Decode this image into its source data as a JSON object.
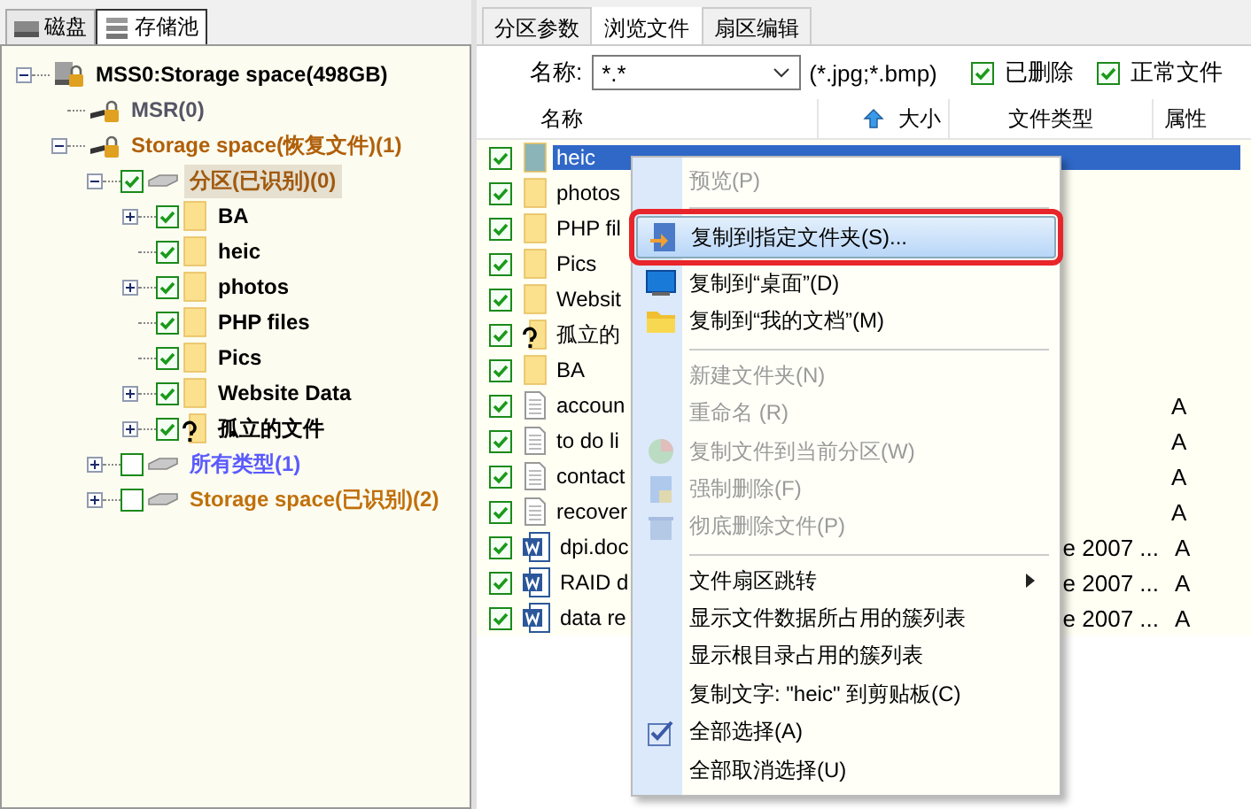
{
  "left_tabs": [
    {
      "label": "磁盘",
      "selected": false
    },
    {
      "label": "存储池",
      "selected": true
    }
  ],
  "tree": [
    {
      "label": "MSS0:Storage space(498GB)",
      "kind": "locked-disk",
      "color": "#000000",
      "expanded": true,
      "selected": false,
      "children": [
        {
          "label": "MSR(0)",
          "kind": "locked-volume",
          "color": "#555566",
          "selected": false
        },
        {
          "label": "Storage space(恢复文件)(1)",
          "kind": "locked-volume",
          "color": "#b0600a",
          "expanded": true,
          "selected": false,
          "children": [
            {
              "label": "分区(已识别)(0)",
              "kind": "partition",
              "color": "#a05a10",
              "expanded": true,
              "checked": true,
              "selected": true,
              "children": [
                {
                  "label": "BA",
                  "kind": "folder",
                  "color": "#000000",
                  "expanded": false,
                  "checked": true,
                  "selected": false
                },
                {
                  "label": "heic",
                  "kind": "folder",
                  "color": "#000000",
                  "checked": true,
                  "selected": false
                },
                {
                  "label": "photos",
                  "kind": "folder",
                  "color": "#000000",
                  "expanded": false,
                  "checked": true,
                  "selected": false
                },
                {
                  "label": "PHP files",
                  "kind": "folder",
                  "color": "#000000",
                  "checked": true,
                  "selected": false
                },
                {
                  "label": "Pics",
                  "kind": "folder",
                  "color": "#000000",
                  "checked": true,
                  "selected": false
                },
                {
                  "label": "Website Data",
                  "kind": "folder",
                  "color": "#000000",
                  "expanded": false,
                  "checked": true,
                  "selected": false
                },
                {
                  "label": "孤立的文件",
                  "kind": "lost-folder",
                  "color": "#000000",
                  "expanded": false,
                  "checked": true,
                  "selected": false
                }
              ]
            },
            {
              "label": "所有类型(1)",
              "kind": "partition",
              "color": "#5a5aff",
              "expanded": false,
              "checked": false,
              "selected": false
            },
            {
              "label": "Storage space(已识别)(2)",
              "kind": "partition",
              "color": "#c0700a",
              "expanded": false,
              "checked": false,
              "selected": false
            }
          ]
        }
      ]
    }
  ],
  "tabs": [
    {
      "label": "分区参数",
      "selected": false
    },
    {
      "label": "浏览文件",
      "selected": true
    },
    {
      "label": "扇区编辑",
      "selected": false
    }
  ],
  "filter": {
    "label": "名称:",
    "value": "*.*",
    "hint": "(*.jpg;*.bmp)",
    "options": [
      {
        "label": "已删除",
        "checked": true
      },
      {
        "label": "正常文件",
        "checked": true
      }
    ]
  },
  "table": {
    "columns": [
      "名称",
      "大小",
      "文件类型",
      "属性"
    ],
    "rows": [
      {
        "name": "heic",
        "kind": "folder",
        "checked": true,
        "selected": true
      },
      {
        "name": "photos",
        "kind": "folder",
        "checked": true,
        "selected": false
      },
      {
        "name": "PHP fil",
        "kind": "folder",
        "checked": true,
        "selected": false
      },
      {
        "name": "Pics",
        "kind": "folder",
        "checked": true,
        "selected": false
      },
      {
        "name": "Websit",
        "kind": "folder",
        "checked": true,
        "selected": false
      },
      {
        "name": "孤立的",
        "kind": "lost-folder",
        "checked": true,
        "selected": false
      },
      {
        "name": "BA",
        "kind": "folder",
        "checked": true,
        "selected": false
      },
      {
        "name": "accoun",
        "kind": "file",
        "checked": true,
        "selected": false,
        "attr": "A"
      },
      {
        "name": "to do li",
        "kind": "file",
        "checked": true,
        "selected": false,
        "attr": "A"
      },
      {
        "name": "contact",
        "kind": "file",
        "checked": true,
        "selected": false,
        "attr": "A"
      },
      {
        "name": "recover",
        "kind": "file",
        "checked": true,
        "selected": false,
        "attr": "A"
      },
      {
        "name": "dpi.doc",
        "kind": "word",
        "checked": true,
        "selected": false,
        "type": "e 2007 ...",
        "attr": "A"
      },
      {
        "name": "RAID d",
        "kind": "word",
        "checked": true,
        "selected": false,
        "type": "e 2007 ...",
        "attr": "A"
      },
      {
        "name": "data re",
        "kind": "word",
        "checked": true,
        "selected": false,
        "type": "e 2007 ...",
        "attr": "A"
      }
    ]
  },
  "context_menu": [
    {
      "kind": "item",
      "label": "预览(P)",
      "disabled": true
    },
    {
      "kind": "separator"
    },
    {
      "kind": "item",
      "label": "复制到指定文件夹(S)...",
      "disabled": false,
      "highlighted": true
    },
    {
      "kind": "item",
      "label": "复制到“桌面”(D)",
      "disabled": false
    },
    {
      "kind": "item",
      "label": "复制到“我的文档”(M)",
      "disabled": false
    },
    {
      "kind": "separator"
    },
    {
      "kind": "item",
      "label": "新建文件夹(N)",
      "disabled": true
    },
    {
      "kind": "item",
      "label": "重命名 (R)",
      "disabled": true
    },
    {
      "kind": "item",
      "label": "复制文件到当前分区(W)",
      "disabled": true
    },
    {
      "kind": "item",
      "label": "强制删除(F)",
      "disabled": true
    },
    {
      "kind": "item",
      "label": "彻底删除文件(P)",
      "disabled": true
    },
    {
      "kind": "separator"
    },
    {
      "kind": "item",
      "label": "文件扇区跳转",
      "disabled": false,
      "submenu": true
    },
    {
      "kind": "item",
      "label": "显示文件数据所占用的簇列表",
      "disabled": false
    },
    {
      "kind": "item",
      "label": "显示根目录占用的簇列表",
      "disabled": false
    },
    {
      "kind": "item",
      "label": "复制文字: \"heic\" 到剪贴板(C)",
      "disabled": false
    },
    {
      "kind": "item",
      "label": "全部选择(A)",
      "disabled": false
    },
    {
      "kind": "item",
      "label": "全部取消选择(U)",
      "disabled": false
    }
  ]
}
